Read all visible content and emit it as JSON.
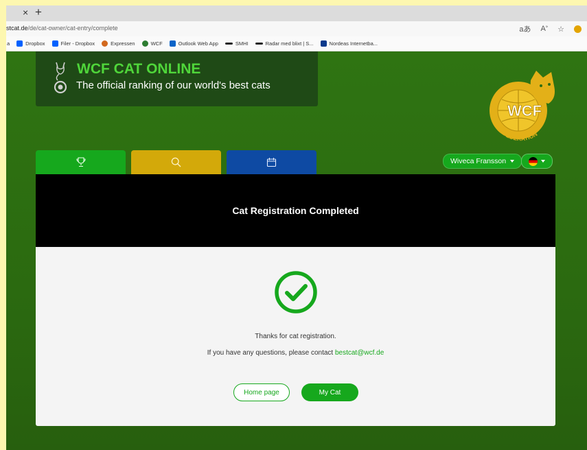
{
  "browser": {
    "tab_close": "×",
    "tab_new": "+",
    "url_host": "stcat.de",
    "url_path": "/de/cat-owner/cat-entry/complete",
    "bookmarks": [
      {
        "label": "Dropbox",
        "color": "#0061fe"
      },
      {
        "label": "Filer - Dropbox",
        "color": "#0061fe"
      },
      {
        "label": "Expressen",
        "color": "#d2691e"
      },
      {
        "label": "WCF",
        "color": "#2e7d32"
      },
      {
        "label": "Outlook Web App",
        "color": "#0a64c8"
      },
      {
        "label": "SMHI",
        "color": "#222222"
      },
      {
        "label": "Radar med blixt | S...",
        "color": "#222222"
      },
      {
        "label": "Nordeas Internetba...",
        "color": "#0b3a8c"
      }
    ]
  },
  "header": {
    "title": "WCF CAT ONLINE",
    "subtitle": "The official ranking of our world's best cats",
    "logo_text": "WCF",
    "logo_ring_text": "WORLD CAT FEDERATION"
  },
  "nav": {
    "tabs": [
      {
        "icon": "trophy-icon",
        "color": "#16a81d"
      },
      {
        "icon": "search-icon",
        "color": "#d3a90a"
      },
      {
        "icon": "calendar-icon",
        "color": "#0e4aa3"
      }
    ],
    "user_name": "Wiveca Fransson"
  },
  "page": {
    "title": "Cat Registration Completed",
    "thanks": "Thanks for cat registration.",
    "contact_prefix": "If you have any questions, please contact",
    "contact_email": "bestcat@wcf.de",
    "home_button": "Home page",
    "mycat_button": "My Cat"
  },
  "colors": {
    "accent_green": "#16a81d",
    "bright_green": "#4fd63a",
    "gold": "#e3b018",
    "page_bg": "#2e6d12"
  }
}
